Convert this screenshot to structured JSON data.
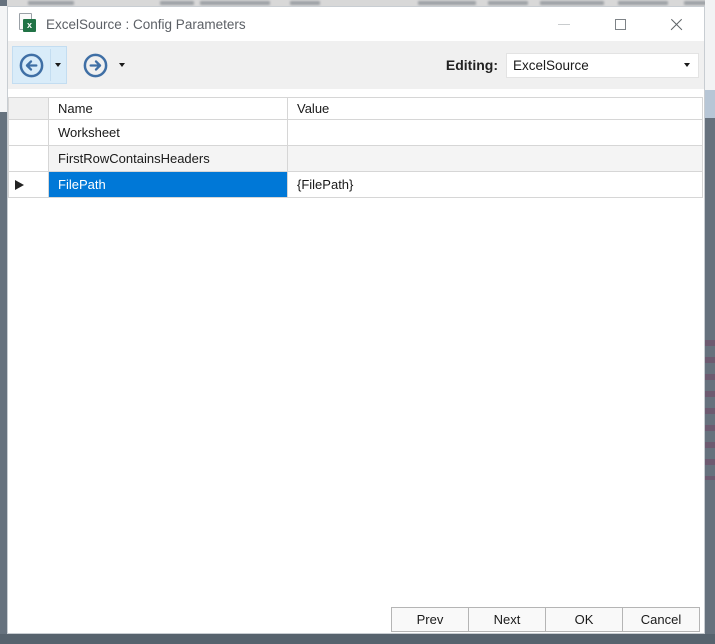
{
  "window": {
    "title": "ExcelSource : Config Parameters"
  },
  "toolbar": {
    "editing_label": "Editing:",
    "editing_value": "ExcelSource"
  },
  "grid": {
    "columns": [
      "Name",
      "Value"
    ],
    "rows": [
      {
        "name": "Worksheet",
        "value": "",
        "selected": false
      },
      {
        "name": "FirstRowContainsHeaders",
        "value": "",
        "selected": false
      },
      {
        "name": "FilePath",
        "value": "{FilePath}",
        "selected": true
      }
    ]
  },
  "footer": {
    "buttons": [
      "Prev",
      "Next",
      "OK",
      "Cancel"
    ]
  },
  "icons": {
    "app": "excel-icon",
    "back": "back-circle-arrow-icon",
    "forward": "forward-circle-arrow-icon"
  },
  "colors": {
    "selection_blue": "#0078d7",
    "nav_icon_blue": "#3f6fa5",
    "nav_hover_bg": "#d9ecf9",
    "toolbar_bg": "#f0f0f0",
    "grid_line": "#d6d6d6",
    "alt_row_bg": "#f4f4f4",
    "window_edge_dark": "#57636e"
  }
}
